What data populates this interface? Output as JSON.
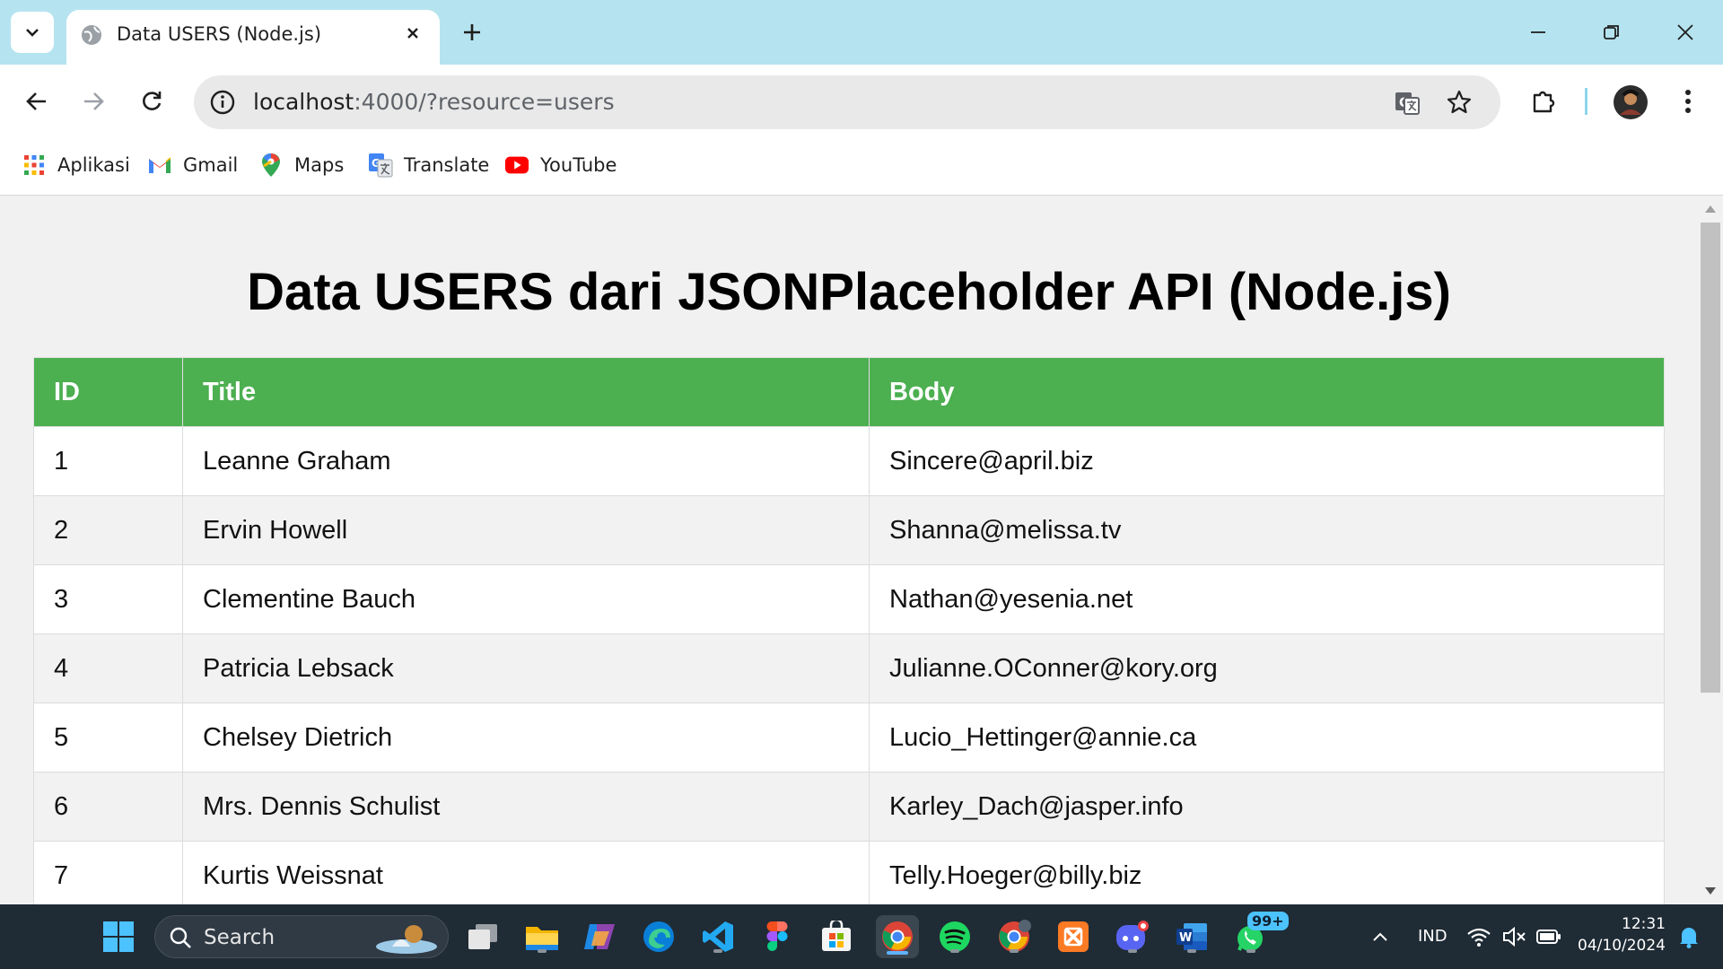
{
  "browser": {
    "tab_title": "Data USERS (Node.js)",
    "url_host": "localhost",
    "url_rest": ":4000/?resource=users",
    "bookmarks": [
      {
        "label": "Aplikasi",
        "icon": "apps-grid-icon"
      },
      {
        "label": "Gmail",
        "icon": "gmail-icon"
      },
      {
        "label": "Maps",
        "icon": "maps-icon"
      },
      {
        "label": "Translate",
        "icon": "translate-icon"
      },
      {
        "label": "YouTube",
        "icon": "youtube-icon"
      }
    ]
  },
  "page": {
    "title": "Data USERS dari JSONPlaceholder API (Node.js)",
    "columns": [
      "ID",
      "Title",
      "Body"
    ],
    "rows": [
      {
        "id": "1",
        "title": "Leanne Graham",
        "body": "Sincere@april.biz"
      },
      {
        "id": "2",
        "title": "Ervin Howell",
        "body": "Shanna@melissa.tv"
      },
      {
        "id": "3",
        "title": "Clementine Bauch",
        "body": "Nathan@yesenia.net"
      },
      {
        "id": "4",
        "title": "Patricia Lebsack",
        "body": "Julianne.OConner@kory.org"
      },
      {
        "id": "5",
        "title": "Chelsey Dietrich",
        "body": "Lucio_Hettinger@annie.ca"
      },
      {
        "id": "6",
        "title": "Mrs. Dennis Schulist",
        "body": "Karley_Dach@jasper.info"
      },
      {
        "id": "7",
        "title": "Kurtis Weissnat",
        "body": "Telly.Hoeger@billy.biz"
      }
    ]
  },
  "taskbar": {
    "search_label": "Search",
    "language": "IND",
    "time": "12:31",
    "date": "04/10/2024",
    "whatsapp_badge": "99+"
  },
  "colors": {
    "header_green": "#4caf50",
    "tabbar_bg": "#b5e4f0",
    "taskbar_bg": "#1f2b35"
  }
}
